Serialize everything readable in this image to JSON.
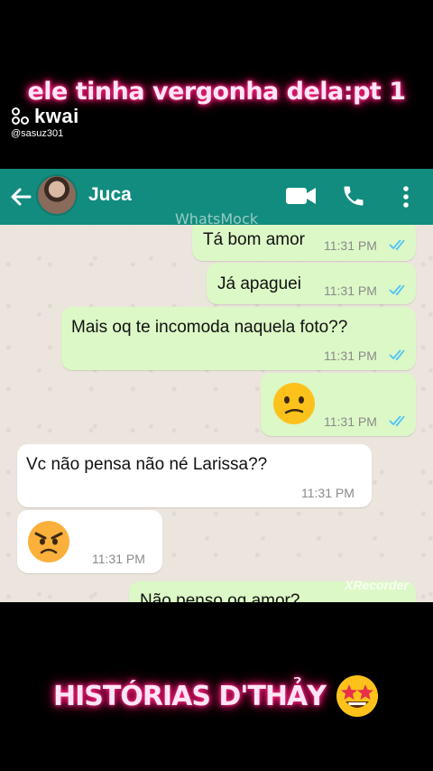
{
  "overlay": {
    "top_caption": "ele tinha vergonha dela:pt 1",
    "app_logo": "kwai",
    "username": "@sasuz301",
    "bottom_caption": "HISTÓRIAS D'THẢY",
    "bottom_emoji": "star-struck-emoji",
    "recorder_watermark": "XRecorder"
  },
  "chat": {
    "contact_name": "Juca",
    "watermark": "WhatsMock",
    "header_icons": [
      "back-arrow-icon",
      "video-call-icon",
      "phone-call-icon",
      "more-options-icon"
    ],
    "colors": {
      "header": "#128c7e",
      "outgoing": "#dcf8c6",
      "incoming": "#ffffff",
      "read_ticks": "#4fc3f7"
    },
    "messages": [
      {
        "direction": "out",
        "text": "Tá bom amor",
        "time": "11:31 PM",
        "read": true
      },
      {
        "direction": "out",
        "text": "Já apaguei",
        "time": "11:31 PM",
        "read": true
      },
      {
        "direction": "out",
        "text": "Mais oq te incomoda naquela foto??",
        "time": "11:31 PM",
        "read": true
      },
      {
        "direction": "out",
        "emoji": "confused-face-emoji",
        "time": "11:31 PM",
        "read": true
      },
      {
        "direction": "in",
        "text": "Vc não pensa não né Larissa??",
        "time": "11:31 PM"
      },
      {
        "direction": "in",
        "emoji": "angry-face-emoji",
        "time": "11:31 PM"
      },
      {
        "direction": "out",
        "text": "Não penso oq amor?"
      }
    ]
  }
}
